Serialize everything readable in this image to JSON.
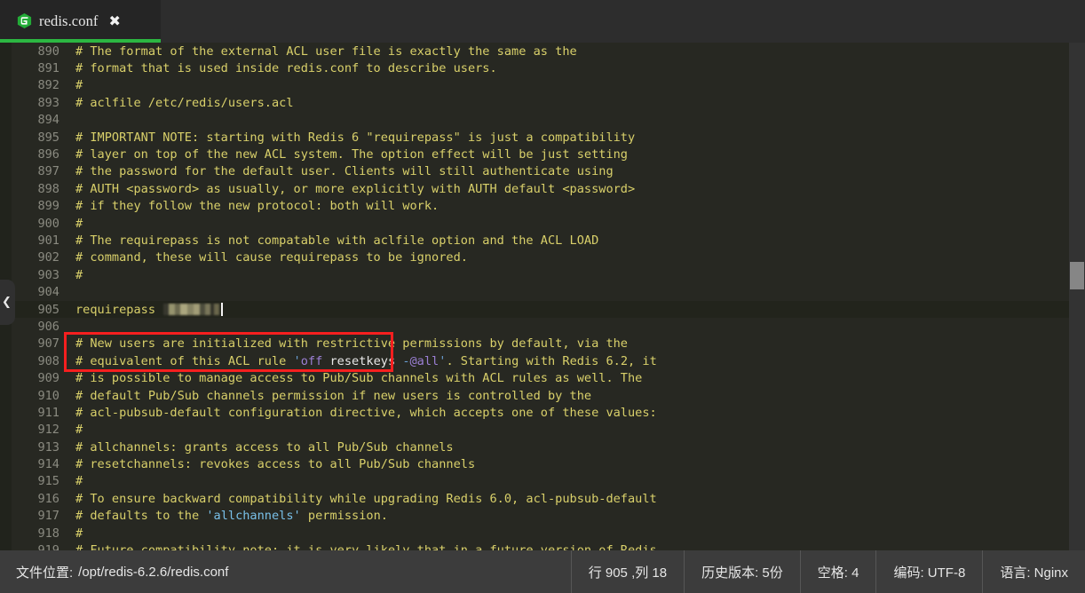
{
  "tab": {
    "icon": "gitee-hexagon-icon",
    "title": "redis.conf",
    "close_label": "✖",
    "accent_color": "#2cb742"
  },
  "editor": {
    "collapse_handle_glyph": "❮",
    "first_line": 890,
    "active_line": 905,
    "lines": [
      {
        "n": 890,
        "segs": [
          {
            "t": "# The format of the external ACL user file is exactly the same as the",
            "c": "cm"
          }
        ]
      },
      {
        "n": 891,
        "segs": [
          {
            "t": "# format that is used inside redis.conf to describe users.",
            "c": "cm"
          }
        ]
      },
      {
        "n": 892,
        "segs": [
          {
            "t": "#",
            "c": "cm"
          }
        ]
      },
      {
        "n": 893,
        "segs": [
          {
            "t": "# aclfile /etc/redis/users.acl",
            "c": "cm"
          }
        ]
      },
      {
        "n": 894,
        "segs": []
      },
      {
        "n": 895,
        "segs": [
          {
            "t": "# IMPORTANT NOTE: starting with Redis 6 \"requirepass\" is just a compatibility",
            "c": "cm"
          }
        ]
      },
      {
        "n": 896,
        "segs": [
          {
            "t": "# layer on top of the new ACL system. The option effect will be just setting",
            "c": "cm"
          }
        ]
      },
      {
        "n": 897,
        "segs": [
          {
            "t": "# the password for the default user. Clients will still authenticate using",
            "c": "cm"
          }
        ]
      },
      {
        "n": 898,
        "segs": [
          {
            "t": "# AUTH <password> as usually, or more explicitly with AUTH default <password>",
            "c": "cm"
          }
        ]
      },
      {
        "n": 899,
        "segs": [
          {
            "t": "# if they follow the new protocol: both will work.",
            "c": "cm"
          }
        ]
      },
      {
        "n": 900,
        "segs": [
          {
            "t": "#",
            "c": "cm"
          }
        ]
      },
      {
        "n": 901,
        "segs": [
          {
            "t": "# The requirepass is not compatable with aclfile option and the ACL LOAD",
            "c": "cm"
          }
        ]
      },
      {
        "n": 902,
        "segs": [
          {
            "t": "# command, these will cause requirepass to be ignored.",
            "c": "cm"
          }
        ]
      },
      {
        "n": 903,
        "segs": [
          {
            "t": "#",
            "c": "cm"
          }
        ]
      },
      {
        "n": 904,
        "segs": []
      },
      {
        "n": 905,
        "segs": [
          {
            "t": "requirepass ",
            "c": "kw"
          }
        ],
        "redacted": true,
        "caret": true,
        "active": true
      },
      {
        "n": 906,
        "segs": []
      },
      {
        "n": 907,
        "segs": [
          {
            "t": "# New users are initialized with restrictive permissions by default, via the",
            "c": "cm"
          }
        ]
      },
      {
        "n": 908,
        "segs": [
          {
            "t": "# equivalent of this ACL rule ",
            "c": "cm"
          },
          {
            "t": "'",
            "c": "bl"
          },
          {
            "t": "off",
            "c": "pu"
          },
          {
            "t": " resetkeys ",
            "c": "wh"
          },
          {
            "t": "-",
            "c": "bl"
          },
          {
            "t": "@all",
            "c": "pu"
          },
          {
            "t": "'",
            "c": "bl"
          },
          {
            "t": ". Starting with Redis 6.2, it",
            "c": "cm"
          }
        ]
      },
      {
        "n": 909,
        "segs": [
          {
            "t": "# is possible to manage access to Pub/Sub channels with ACL rules as well. The",
            "c": "cm"
          }
        ]
      },
      {
        "n": 910,
        "segs": [
          {
            "t": "# default Pub/Sub channels permission if new users is controlled by the",
            "c": "cm"
          }
        ]
      },
      {
        "n": 911,
        "segs": [
          {
            "t": "# acl-pubsub-default configuration directive, which accepts one of these values:",
            "c": "cm"
          }
        ]
      },
      {
        "n": 912,
        "segs": [
          {
            "t": "#",
            "c": "cm"
          }
        ]
      },
      {
        "n": 913,
        "segs": [
          {
            "t": "# allchannels: grants access to all Pub/Sub channels",
            "c": "cm"
          }
        ]
      },
      {
        "n": 914,
        "segs": [
          {
            "t": "# resetchannels: revokes access to all Pub/Sub channels",
            "c": "cm"
          }
        ]
      },
      {
        "n": 915,
        "segs": [
          {
            "t": "#",
            "c": "cm"
          }
        ]
      },
      {
        "n": 916,
        "segs": [
          {
            "t": "# To ensure backward compatibility while upgrading Redis 6.0, acl-pubsub-default",
            "c": "cm"
          }
        ]
      },
      {
        "n": 917,
        "segs": [
          {
            "t": "# defaults to the ",
            "c": "cm"
          },
          {
            "t": "'allchannels'",
            "c": "cy"
          },
          {
            "t": " permission.",
            "c": "cm"
          }
        ]
      },
      {
        "n": 918,
        "segs": [
          {
            "t": "#",
            "c": "cm"
          }
        ]
      },
      {
        "n": 919,
        "segs": [
          {
            "t": "# Future compatibility note: it is very likely that in a future version of Redis",
            "c": "cm"
          }
        ]
      }
    ]
  },
  "annotation": {
    "type": "red-rectangle",
    "color": "#f61f1f",
    "targets_line": 905
  },
  "statusbar": {
    "file_location_label": "文件位置:",
    "file_location_value": "/opt/redis-6.2.6/redis.conf",
    "cells": [
      {
        "name": "cursor-position",
        "text": "行 905 ,列 18"
      },
      {
        "name": "history-versions",
        "text": "历史版本: 5份"
      },
      {
        "name": "indent-spaces",
        "text": "空格: 4"
      },
      {
        "name": "encoding",
        "text": "编码: UTF-8"
      },
      {
        "name": "language-mode",
        "text": "语言: Nginx"
      }
    ]
  }
}
